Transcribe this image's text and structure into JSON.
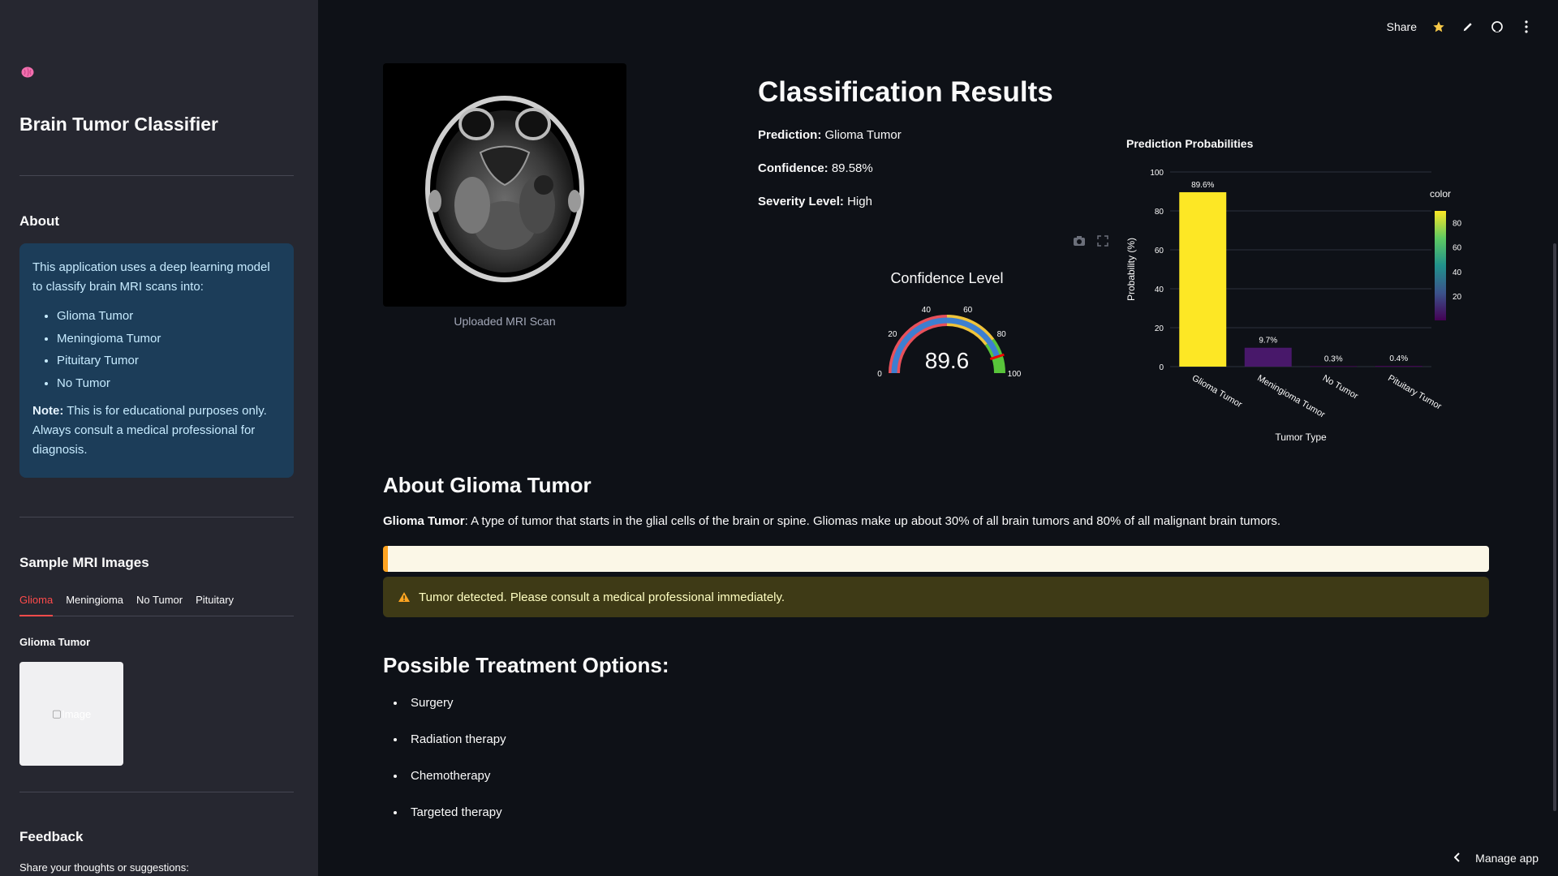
{
  "sidebar": {
    "icon": "brain-icon",
    "app_title": "Brain Tumor Classifier",
    "about_heading": "About",
    "about_text": "This application uses a deep learning model to classify brain MRI scans into:",
    "classes": [
      "Glioma Tumor",
      "Meningioma Tumor",
      "Pituitary Tumor",
      "No Tumor"
    ],
    "note_label": "Note:",
    "note_text": " This is for educational purposes only. Always consult a medical professional for diagnosis.",
    "samples_heading": "Sample MRI Images",
    "tabs": [
      "Glioma",
      "Meningioma",
      "No Tumor",
      "Pituitary"
    ],
    "active_tab": "Glioma",
    "sample_label": "Glioma Tumor",
    "sample_alt": "Image",
    "feedback_heading": "Feedback",
    "feedback_prompt": "Share your thoughts or suggestions:"
  },
  "toolbar": {
    "share_label": "Share",
    "icons": [
      "star-icon",
      "edit-icon",
      "github-icon",
      "more-icon"
    ],
    "star_color": "#f7c948"
  },
  "main": {
    "mri_caption": "Uploaded MRI Scan",
    "results_title": "Classification Results",
    "prediction_label": "Prediction:",
    "prediction_value": " Glioma Tumor",
    "confidence_label": "Confidence:",
    "confidence_value": " 89.58%",
    "severity_label": "Severity Level:",
    "severity_value": " High",
    "gauge": {
      "title": "Confidence Level",
      "value_text": "89.6",
      "value": 89.6,
      "ticks": [
        "0",
        "20",
        "40",
        "60",
        "80",
        "100"
      ]
    },
    "about_heading": "About Glioma Tumor",
    "about_term": "Glioma Tumor",
    "about_text": ": A type of tumor that starts in the glial cells of the brain or spine. Gliomas make up about 30% of all brain tumors and 80% of all malignant brain tumors.",
    "warning_text": "Tumor detected. Please consult a medical professional immediately.",
    "warning_color": "#ffa421",
    "treatment_heading": "Possible Treatment Options:",
    "treatments": [
      "Surgery",
      "Radiation therapy",
      "Chemotherapy",
      "Targeted therapy"
    ],
    "manage_label": "Manage app"
  },
  "chart_data": {
    "type": "bar",
    "title": "Prediction Probabilities",
    "xlabel": "Tumor Type",
    "ylabel": "Probability (%)",
    "categories": [
      "Glioma Tumor",
      "Meningioma Tumor",
      "No Tumor",
      "Pituitary Tumor"
    ],
    "values": [
      89.6,
      9.7,
      0.3,
      0.4
    ],
    "data_labels": [
      "89.6%",
      "9.7%",
      "0.3%",
      "0.4%"
    ],
    "ylim": [
      0,
      100
    ],
    "yticks": [
      "0",
      "20",
      "40",
      "60",
      "80",
      "100"
    ],
    "colorbar": {
      "title": "color",
      "ticks": [
        "20",
        "40",
        "60",
        "80"
      ]
    },
    "grid": true,
    "legend": "colorbar right"
  }
}
